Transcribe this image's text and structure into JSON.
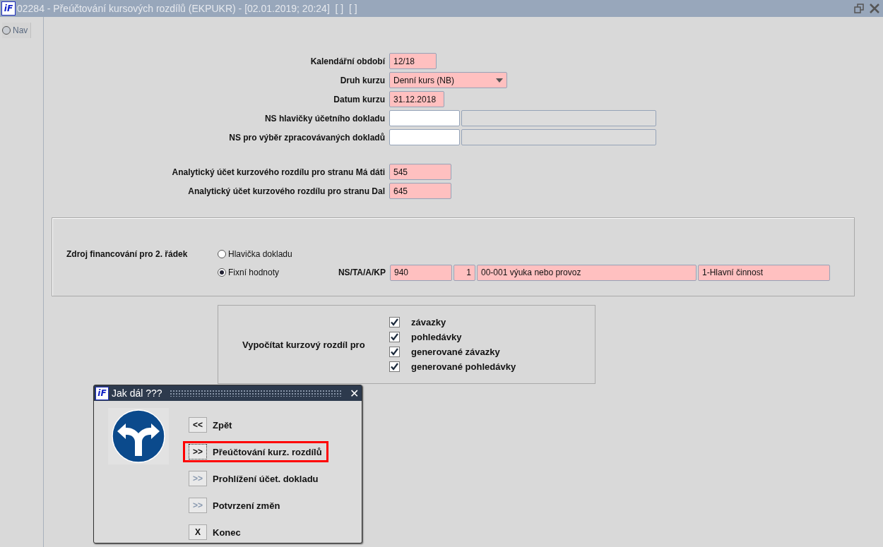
{
  "window": {
    "logo": "iF",
    "title": "02284 - Přeúčtování kursových rozdílů (EKPUKR) - [02.01.2019; 20:24]  [ ]  [ ]"
  },
  "nav": {
    "label": "Nav"
  },
  "form": {
    "groups": [
      {
        "rows": [
          {
            "label": "Kalendářní období",
            "inputs": [
              {
                "kind": "required",
                "value": "12/18"
              }
            ]
          },
          {
            "label": "Druh kurzu",
            "inputs": [
              {
                "kind": "select",
                "value": "Denní kurs (NB)"
              }
            ]
          },
          {
            "label": "Datum kurzu",
            "inputs": [
              {
                "kind": "required",
                "value": "31.12.2018"
              }
            ]
          },
          {
            "label": "NS hlavičky účetního dokladu",
            "inputs": [
              {
                "kind": "empty"
              },
              {
                "kind": "readonly"
              }
            ]
          },
          {
            "label": "NS pro výběr zpracovávaných dokladů",
            "inputs": [
              {
                "kind": "empty"
              },
              {
                "kind": "readonly"
              }
            ]
          }
        ]
      },
      {
        "rows": [
          {
            "label": "Analytický účet kurzového rozdílu pro stranu Má dáti",
            "inputs": [
              {
                "kind": "required",
                "value": "545"
              }
            ]
          },
          {
            "label": "Analytický účet kurzového rozdílu pro stranu Dal",
            "inputs": [
              {
                "kind": "required",
                "value": "645"
              }
            ]
          }
        ]
      }
    ]
  },
  "source": {
    "label": "Zdroj financování pro 2. řádek",
    "options": [
      {
        "label": "Hlavička dokladu",
        "selected": false
      },
      {
        "label": "Fixní hodnoty",
        "selected": true
      }
    ],
    "fields_label": "NS/TA/A/KP",
    "inputs": [
      {
        "kind": "required",
        "value": "940"
      },
      {
        "kind": "number",
        "value": "1"
      },
      {
        "kind": "required",
        "value": "00-001 výuka nebo provoz"
      },
      {
        "kind": "required",
        "value": "1-Hlavní činnost"
      }
    ]
  },
  "calculate": {
    "label": "Vypočítat kurzový rozdíl pro",
    "items": [
      {
        "label": "závazky",
        "checked": true
      },
      {
        "label": "pohledávky",
        "checked": true
      },
      {
        "label": "generované závazky",
        "checked": true
      },
      {
        "label": "generované pohledávky",
        "checked": true
      }
    ]
  },
  "dialog": {
    "logo": "iF",
    "title": "Jak dál ???",
    "close": "✕",
    "actions": [
      {
        "key": "<<",
        "label": "Zpět",
        "selected": false,
        "disabled": false
      },
      {
        "key": ">>",
        "label": "Přeúčtování kurz. rozdílů",
        "selected": true,
        "disabled": false
      },
      {
        "key": ">>",
        "label": "Prohlížení účet. dokladu",
        "selected": false,
        "disabled": true
      },
      {
        "key": ">>",
        "label": "Potvrzení změn",
        "selected": false,
        "disabled": true
      },
      {
        "key": "X",
        "label": "Konec",
        "selected": false,
        "disabled": false
      }
    ]
  }
}
